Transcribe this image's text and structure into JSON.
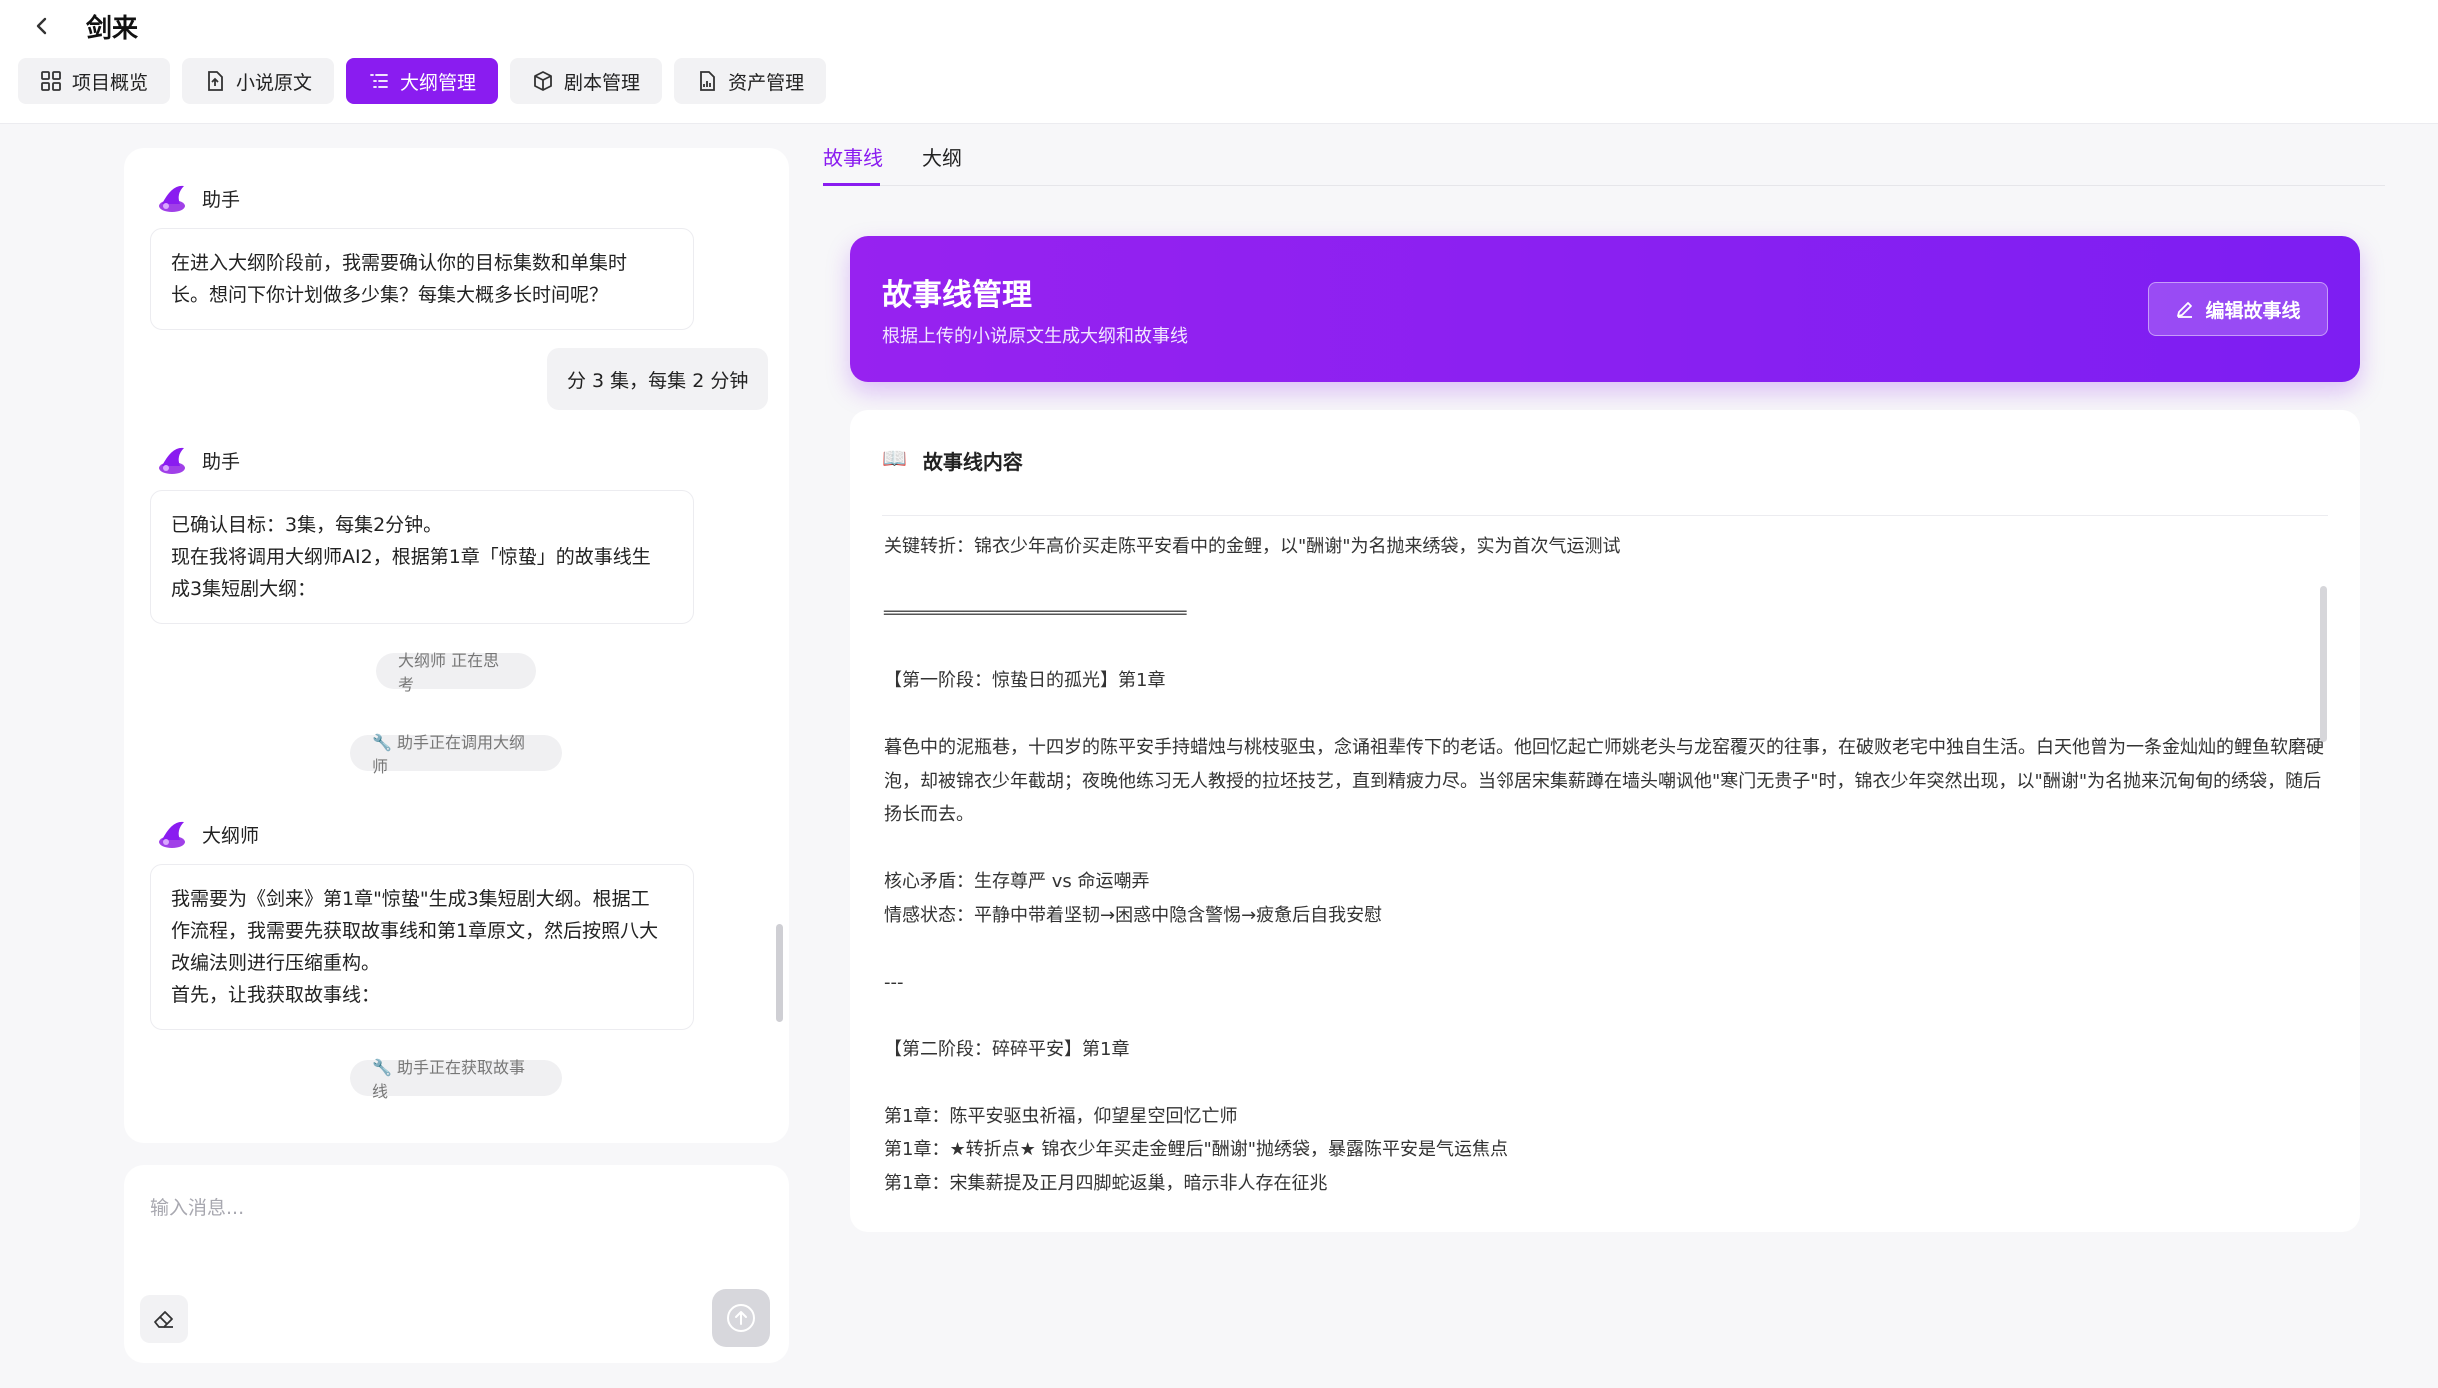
{
  "header": {
    "title": "剑来",
    "tabs": [
      {
        "label": "项目概览",
        "icon": "grid-icon",
        "active": false
      },
      {
        "label": "小说原文",
        "icon": "document-icon",
        "active": false
      },
      {
        "label": "大纲管理",
        "icon": "list-icon",
        "active": true
      },
      {
        "label": "剧本管理",
        "icon": "cube-icon",
        "active": false
      },
      {
        "label": "资产管理",
        "icon": "chart-doc-icon",
        "active": false
      }
    ]
  },
  "chat": {
    "messages": [
      {
        "role": "assistant",
        "sender": "助手",
        "lines": [
          "在进入大纲阶段前，我需要确认你的目标集数和单集时",
          "长。想问下你计划做多少集？每集大概多长时间呢？"
        ]
      },
      {
        "role": "user",
        "text": "分 3 集，每集 2 分钟"
      },
      {
        "role": "assistant",
        "sender": "助手",
        "lines": [
          "已确认目标：3集，每集2分钟。",
          "现在我将调用大纲师AI2，根据第1章「惊蛰」的故事线生",
          "成3集短剧大纲："
        ]
      },
      {
        "role": "status",
        "text": "大纲师 正在思考"
      },
      {
        "role": "status",
        "text": "🔧 助手正在调用大纲师"
      },
      {
        "role": "assistant",
        "sender": "大纲师",
        "lines": [
          "我需要为《剑来》第1章\"惊蛰\"生成3集短剧大纲。根据工",
          "作流程，我需要先获取故事线和第1章原文，然后按照八大",
          "改编法则进行压缩重构。",
          "首先，让我获取故事线："
        ]
      },
      {
        "role": "status",
        "text": "🔧 助手正在获取故事线"
      }
    ],
    "input_placeholder": "输入消息..."
  },
  "right": {
    "tabs": [
      {
        "label": "故事线",
        "active": true
      },
      {
        "label": "大纲",
        "active": false
      }
    ],
    "banner": {
      "title": "故事线管理",
      "subtitle": "根据上传的小说原文生成大纲和故事线",
      "edit_label": "编辑故事线"
    },
    "card": {
      "icon": "📖",
      "title": "故事线内容",
      "lines": [
        "关键转折：锦衣少年高价买走陈平安看中的金鲤，以\"酬谢\"为名抛来绣袋，实为首次气运测试",
        "",
        "══════════════════════════════════",
        "",
        "【第一阶段：惊蛰日的孤光】第1章",
        "",
        "暮色中的泥瓶巷，十四岁的陈平安手持蜡烛与桃枝驱虫，念诵祖辈传下的老话。他回忆起亡师姚老头与龙窑覆灭的往事，在破败老宅中独自生活。白天他曾为一条金灿灿的鲤鱼软磨硬泡，却被锦衣少年截胡；夜晚他练习无人教授的拉坯技艺，直到精疲力尽。当邻居宋集薪蹲在墙头嘲讽他\"寒门无贵子\"时，锦衣少年突然出现，以\"酬谢\"为名抛来沉甸甸的绣袋，随后扬长而去。",
        "",
        "核心矛盾：生存尊严 vs 命运嘲弄",
        "情感状态：平静中带着坚韧→困惑中隐含警惕→疲惫后自我安慰",
        "",
        "---",
        "",
        "【第二阶段：碎碎平安】第1章",
        "",
        "第1章：陈平安驱虫祈福，仰望星空回忆亡师",
        "第1章：★转折点★ 锦衣少年买走金鲤后\"酬谢\"抛绣袋，暴露陈平安是气运焦点",
        "第1章：宋集薪提及正月四脚蛇返巢，暗示非人存在征兆"
      ]
    }
  },
  "colors": {
    "accent": "#8a1cf0",
    "banner_start": "#9722f0",
    "banner_end": "#7d1ef2"
  }
}
